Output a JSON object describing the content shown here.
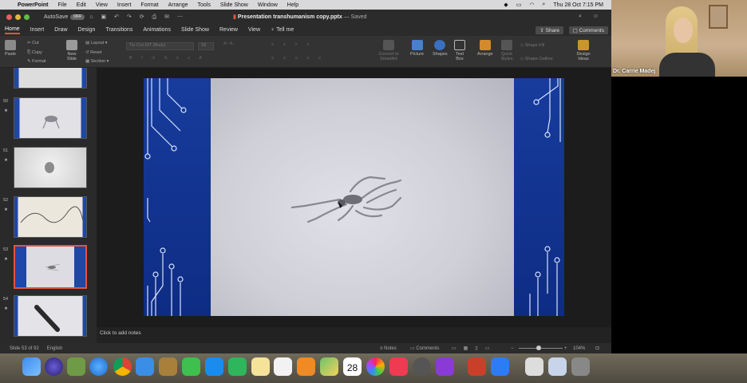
{
  "menubar": {
    "items": [
      "PowerPoint",
      "File",
      "Edit",
      "View",
      "Insert",
      "Format",
      "Arrange",
      "Tools",
      "Slide Show",
      "Window",
      "Help"
    ],
    "datetime": "Thu 28 Oct  7:15 PM"
  },
  "titlebar": {
    "autosave_label": "AutoSave",
    "autosave_state": "OFF",
    "document_title": "Presentation transhumanism copy.pptx",
    "saved_status": "— Saved"
  },
  "ribbon_tabs": {
    "items": [
      "Home",
      "Insert",
      "Draw",
      "Design",
      "Transitions",
      "Animations",
      "Slide Show",
      "Review",
      "View",
      "Tell me"
    ],
    "active": "Home",
    "share_label": "Share",
    "comments_label": "Comments"
  },
  "ribbon": {
    "paste": "Paste",
    "cut": "Cut",
    "copy": "Copy",
    "format": "Format",
    "new_slide": "New Slide",
    "layout": "Layout",
    "reset": "Reset",
    "section": "Section",
    "font_name": "Tw Cen MT (Body)",
    "font_size": "18",
    "convert_smartart": "Convert to SmartArt",
    "picture": "Picture",
    "shapes": "Shapes",
    "text_box": "Text Box",
    "arrange": "Arrange",
    "quick_styles": "Quick Styles",
    "shape_fill": "Shape Fill",
    "shape_outline": "Shape Outline",
    "design_ideas": "Design Ideas"
  },
  "slides": {
    "items": [
      {
        "number": "",
        "kind": "partial"
      },
      {
        "number": "50",
        "kind": "robot"
      },
      {
        "number": "51",
        "kind": "blob"
      },
      {
        "number": "52",
        "kind": "wire"
      },
      {
        "number": "53",
        "kind": "spider",
        "selected": true
      },
      {
        "number": "54",
        "kind": "stick"
      }
    ]
  },
  "notes": {
    "placeholder": "Click to add notes"
  },
  "status": {
    "slide_info": "Slide 53 of 92",
    "language": "English",
    "notes_label": "Notes",
    "comments_label": "Comments",
    "zoom": "104%"
  },
  "video": {
    "participant_name": "Dr. Carrie Madej"
  },
  "colors": {
    "accent": "#e2553d",
    "slide_band": "#173c9c"
  },
  "dock": {
    "calendar_day": "28"
  }
}
